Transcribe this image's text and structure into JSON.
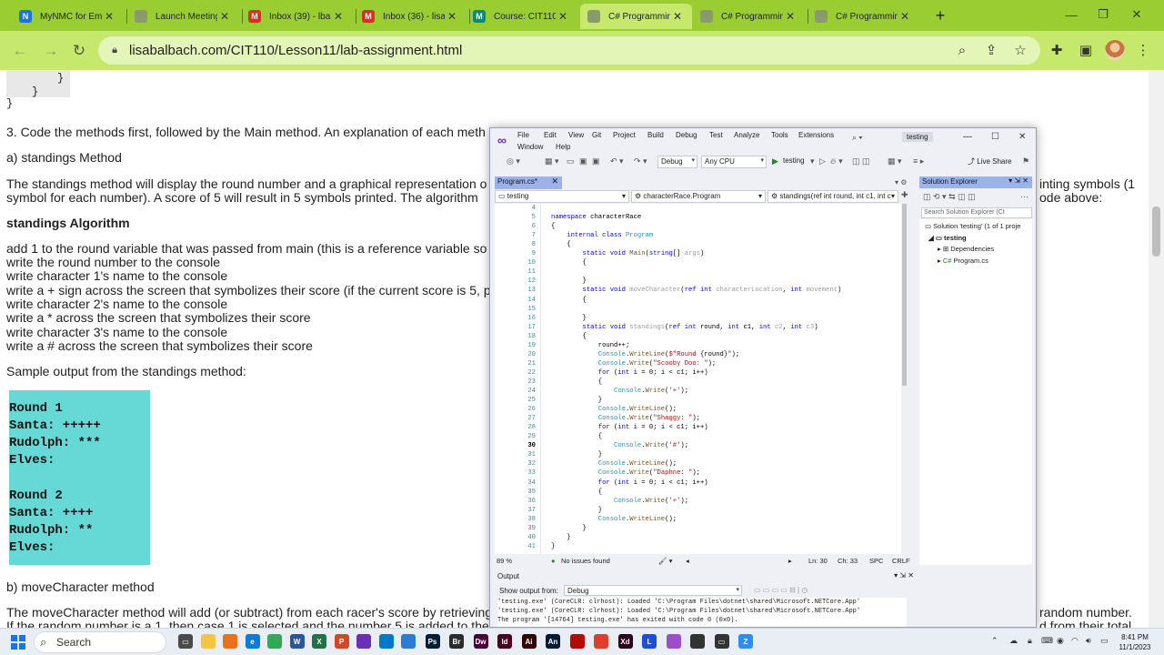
{
  "browser": {
    "tabs": [
      {
        "title": "MyNMC for Emp",
        "fav": "#1a73e8",
        "glyph": "N"
      },
      {
        "title": "Launch Meeting",
        "fav": "#8a9a6a",
        "glyph": ""
      },
      {
        "title": "Inbox (39) - lba",
        "fav": "#d93025",
        "glyph": "M"
      },
      {
        "title": "Inbox (36) - lisa",
        "fav": "#d93025",
        "glyph": "M"
      },
      {
        "title": "Course: CIT110",
        "fav": "#0b8a7a",
        "glyph": "M"
      },
      {
        "title": "C# Programmin",
        "fav": "#8a9a6a",
        "glyph": ""
      },
      {
        "title": "C# Programmin",
        "fav": "#8a9a6a",
        "glyph": ""
      },
      {
        "title": "C# Programmin",
        "fav": "#8a9a6a",
        "glyph": ""
      }
    ],
    "active_tab": 5,
    "url": "lisabalbach.com/CIT110/Lesson11/lab-assignment.html"
  },
  "page": {
    "code_tail": [
      "}",
      "}",
      "}"
    ],
    "step3": "3. Code the methods first, followed by the Main method. An explanation of each meth",
    "standings_heading": "a) standings Method",
    "standings_desc1": "The standings method will display the round number and a graphical representation o",
    "standings_desc1_right": "inting symbols (1",
    "standings_desc2": "symbol for each number). A score of 5 will result in 5 symbols printed. The algorithm",
    "standings_desc2_right": "ode above:",
    "algo_heading": "standings Algorithm",
    "algo_lines": [
      "add 1 to the round variable that was passed from main (this is a reference variable so",
      "write the round number to the console",
      "write character 1's name to the console",
      "write a + sign across the screen that symbolizes their score (if the current score is 5, p",
      "write character 2's name to the console",
      "write a * across the screen that symbolizes their score",
      "write character 3's name to the console",
      "write a # across the screen that symbolizes their score"
    ],
    "sample_label": "Sample output from the standings method:",
    "sample_output": [
      "Round 1",
      "Santa: +++++",
      "Rudolph: ***",
      "Elves:",
      "",
      "Round 2",
      "Santa: ++++",
      "Rudolph: **",
      "Elves:"
    ],
    "move_heading": "b) moveCharacter method",
    "move_desc1": "The moveCharacter method will add (or subtract) from each racer's score by retrieving",
    "move_desc1_right": "random number.",
    "move_desc2": "If the random number is a 1, then case 1 is selected and the number 5 is added to the",
    "move_desc2_right": "d from their total"
  },
  "vs": {
    "menu": [
      "File",
      "Edit",
      "View",
      "Git",
      "Project",
      "Build",
      "Debug",
      "Test",
      "Analyze",
      "Tools",
      "Extensions"
    ],
    "menu2": [
      "Window",
      "Help"
    ],
    "solution_name": "testing",
    "config": "Debug",
    "platform": "Any CPU",
    "run_label": "testing",
    "live_share": "Live Share",
    "doc_tab": "Program.cs*",
    "nav_project": "testing",
    "nav_class": "characterRace.Program",
    "nav_member": "standings(ref int round, int c1, int c",
    "code": [
      {
        "n": "4",
        "html": ""
      },
      {
        "n": "5",
        "html": "<span class=\"kw\">namespace</span> characterRace"
      },
      {
        "n": "6",
        "html": "{"
      },
      {
        "n": "7",
        "html": "    <span class=\"kw\">internal class</span> <span class=\"ty\">Program</span>"
      },
      {
        "n": "8",
        "html": "    {"
      },
      {
        "n": "9",
        "html": "        <span class=\"kw\">static void</span> <span class=\"mth\">Main</span>(<span class=\"kw\">string</span>[] <span class=\"gr\">args</span>)"
      },
      {
        "n": "10",
        "html": "        {"
      },
      {
        "n": "11",
        "html": ""
      },
      {
        "n": "12",
        "html": "        }"
      },
      {
        "n": "13",
        "html": "        <span class=\"kw\">static void</span> <span class=\"gr\">moveCharacter</span>(<span class=\"kw\">ref int</span> <span class=\"gr\">characterLocation</span>, <span class=\"kw\">int</span> <span class=\"gr\">movement</span>)"
      },
      {
        "n": "14",
        "html": "        {"
      },
      {
        "n": "15",
        "html": ""
      },
      {
        "n": "16",
        "html": "        }"
      },
      {
        "n": "17",
        "html": "        <span class=\"kw\">static void</span> <span class=\"gr\">standings</span>(<span class=\"kw\">ref int</span> round, <span class=\"kw\">int</span> c1, <span class=\"kw\">int</span> <span class=\"gr\">c2</span>, <span class=\"kw\">int</span> <span class=\"gr\">c3</span>)"
      },
      {
        "n": "18",
        "html": "        {"
      },
      {
        "n": "19",
        "html": "            round++;"
      },
      {
        "n": "20",
        "html": "            <span class=\"ty\">Console</span>.<span class=\"mth\">WriteLine</span>(<span class=\"str\">$\"Round </span>{round}<span class=\"str\">\"</span>);"
      },
      {
        "n": "21",
        "html": "            <span class=\"ty\">Console</span>.<span class=\"mth\">Write</span>(<span class=\"str\">\"Scooby Doo: \"</span>);"
      },
      {
        "n": "22",
        "html": "            <span class=\"kw\">for</span> (<span class=\"kw\">int</span> i = 0; i &lt; c1; i++)"
      },
      {
        "n": "23",
        "html": "            {"
      },
      {
        "n": "24",
        "html": "                <span class=\"ty\">Console</span>.<span class=\"mth\">Write</span>(<span class=\"str\">'+'</span>);"
      },
      {
        "n": "25",
        "html": "            }"
      },
      {
        "n": "26",
        "html": "            <span class=\"ty\">Console</span>.<span class=\"mth\">WriteLine</span>();"
      },
      {
        "n": "27",
        "html": "            <span class=\"ty\">Console</span>.<span class=\"mth\">Write</span>(<span class=\"str\">\"Shaggy: \"</span>);"
      },
      {
        "n": "28",
        "html": "            <span class=\"kw\">for</span> (<span class=\"kw\">int</span> i = 0; i &lt; c1; i++)"
      },
      {
        "n": "29",
        "html": "            {"
      },
      {
        "n": "30",
        "html": "                <span class=\"ty\">Console</span>.<span class=\"mth\">Write</span>(<span class=\"str\">'#'</span>);"
      },
      {
        "n": "31",
        "html": "            }"
      },
      {
        "n": "32",
        "html": "            <span class=\"ty\">Console</span>.<span class=\"mth\">WriteLine</span>();"
      },
      {
        "n": "33",
        "html": "            <span class=\"ty\">Console</span>.<span class=\"mth\">Write</span>(<span class=\"str\">\"Daphne: \"</span>);"
      },
      {
        "n": "34",
        "html": "            <span class=\"kw\">for</span> (<span class=\"kw\">int</span> i = 0; i &lt; c1; i++)"
      },
      {
        "n": "35",
        "html": "            {"
      },
      {
        "n": "36",
        "html": "                <span class=\"ty\">Console</span>.<span class=\"mth\">Write</span>(<span class=\"str\">'+'</span>);"
      },
      {
        "n": "37",
        "html": "            }"
      },
      {
        "n": "38",
        "html": "            <span class=\"ty\">Console</span>.<span class=\"mth\">WriteLine</span>();"
      },
      {
        "n": "39",
        "html": "        }"
      },
      {
        "n": "40",
        "html": "    }"
      },
      {
        "n": "41",
        "html": "}"
      }
    ],
    "current_line": "30",
    "zoom": "89 %",
    "issues": "No issues found",
    "ln": "Ln: 30",
    "ch": "Ch: 33",
    "spc": "SPC",
    "crlf": "CRLF",
    "solution_explorer": {
      "title": "Solution Explorer",
      "search_placeholder": "Search Solution Explorer (Ct",
      "solution": "Solution 'testing' (1 of 1 proje",
      "project": "testing",
      "dependencies": "Dependencies",
      "file": "Program.cs"
    },
    "output": {
      "title": "Output",
      "show_from": "Show output from:",
      "source": "Debug",
      "lines": [
        "'testing.exe' (CoreCLR: clrhost): Loaded 'C:\\Program Files\\dotnet\\shared\\Microsoft.NETCore.App'",
        "'testing.exe' (CoreCLR: clrhost): Loaded 'C:\\Program Files\\dotnet\\shared\\Microsoft.NETCore.App'",
        "The program '[14764] testing.exe' has exited with code 0 (0x0)."
      ]
    }
  },
  "taskbar": {
    "search_label": "Search",
    "time": "8:41 PM",
    "date": "11/1/2023",
    "apps": [
      {
        "g": "▭",
        "c": "#4a4a4a"
      },
      {
        "g": "",
        "c": "#f5c542"
      },
      {
        "g": "",
        "c": "#e8711a"
      },
      {
        "g": "e",
        "c": "#0a7cd6"
      },
      {
        "g": "",
        "c": "#34a853"
      },
      {
        "g": "W",
        "c": "#2b579a"
      },
      {
        "g": "X",
        "c": "#217346"
      },
      {
        "g": "P",
        "c": "#d24726"
      },
      {
        "g": "",
        "c": "#6a2fb5"
      },
      {
        "g": "",
        "c": "#007acc"
      },
      {
        "g": "",
        "c": "#2b7cd3"
      },
      {
        "g": "Ps",
        "c": "#001e36"
      },
      {
        "g": "Br",
        "c": "#2b2b2b"
      },
      {
        "g": "Dw",
        "c": "#470137"
      },
      {
        "g": "Id",
        "c": "#49021f"
      },
      {
        "g": "Ai",
        "c": "#330000"
      },
      {
        "g": "An",
        "c": "#001a33"
      },
      {
        "g": "",
        "c": "#b30b00"
      },
      {
        "g": "",
        "c": "#e03e2d"
      },
      {
        "g": "Xd",
        "c": "#2e001f"
      },
      {
        "g": "L",
        "c": "#1d4ed8"
      },
      {
        "g": "",
        "c": "#9b4dca"
      },
      {
        "g": "",
        "c": "#333"
      },
      {
        "g": "▭",
        "c": "#333"
      },
      {
        "g": "Z",
        "c": "#2d8cff"
      }
    ]
  },
  "colors": {
    "tabbar": "#9acd32",
    "toolbar": "#c6e86c",
    "sample_bg": "#66d9d6",
    "vs_accent": "#9bb3e6"
  }
}
